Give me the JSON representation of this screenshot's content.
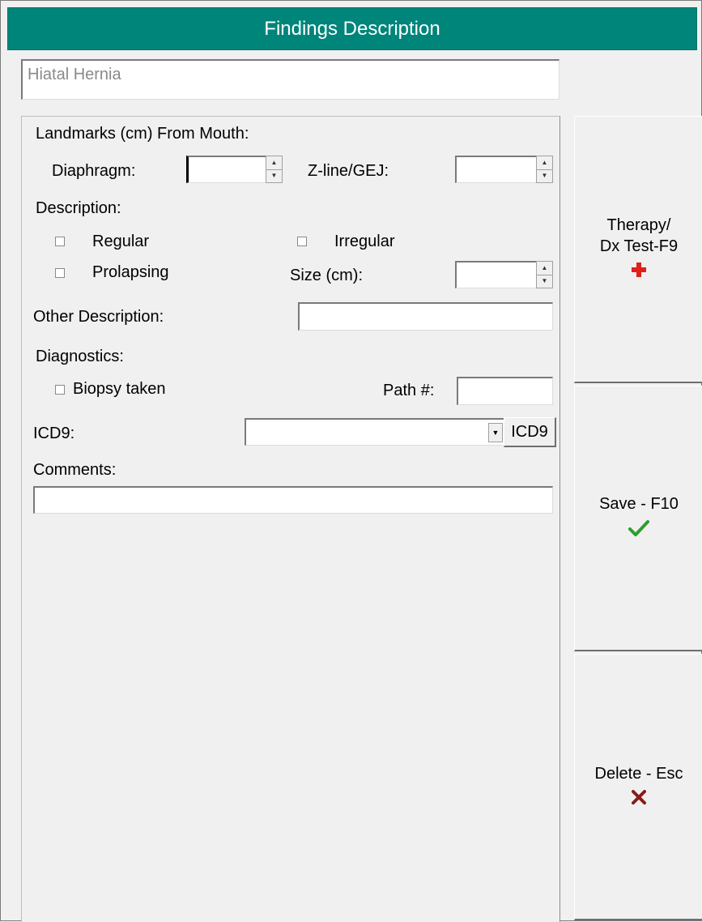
{
  "title": "Findings Description",
  "finding_name": "Hiatal Hernia",
  "landmarks": {
    "heading": "Landmarks (cm) From Mouth:",
    "diaphragm_label": "Diaphragm:",
    "diaphragm_value": "",
    "zline_label": "Z-line/GEJ:",
    "zline_value": ""
  },
  "description": {
    "heading": "Description:",
    "regular_label": "Regular",
    "regular_checked": false,
    "irregular_label": "Irregular",
    "irregular_checked": false,
    "prolapsing_label": "Prolapsing",
    "prolapsing_checked": false,
    "size_label": "Size (cm):",
    "size_value": ""
  },
  "other_description": {
    "label": "Other Description:",
    "value": ""
  },
  "diagnostics": {
    "heading": "Diagnostics:",
    "biopsy_label": "Biopsy taken",
    "biopsy_checked": false,
    "path_label": "Path #:",
    "path_value": ""
  },
  "icd9": {
    "label": "ICD9:",
    "selected": "",
    "button_label": "ICD9"
  },
  "comments": {
    "label": "Comments:",
    "value": ""
  },
  "side_buttons": {
    "therapy_line1": "Therapy/",
    "therapy_line2": "Dx Test-F9",
    "save_label": "Save - F10",
    "delete_label": "Delete - Esc"
  },
  "colors": {
    "titlebar": "#00857a",
    "plus_icon": "#e0201b",
    "check_icon": "#2e9e2e",
    "x_icon": "#8b1a1a"
  },
  "icons": {
    "therapy": "plus-icon",
    "save": "checkmark-icon",
    "delete": "x-icon"
  }
}
